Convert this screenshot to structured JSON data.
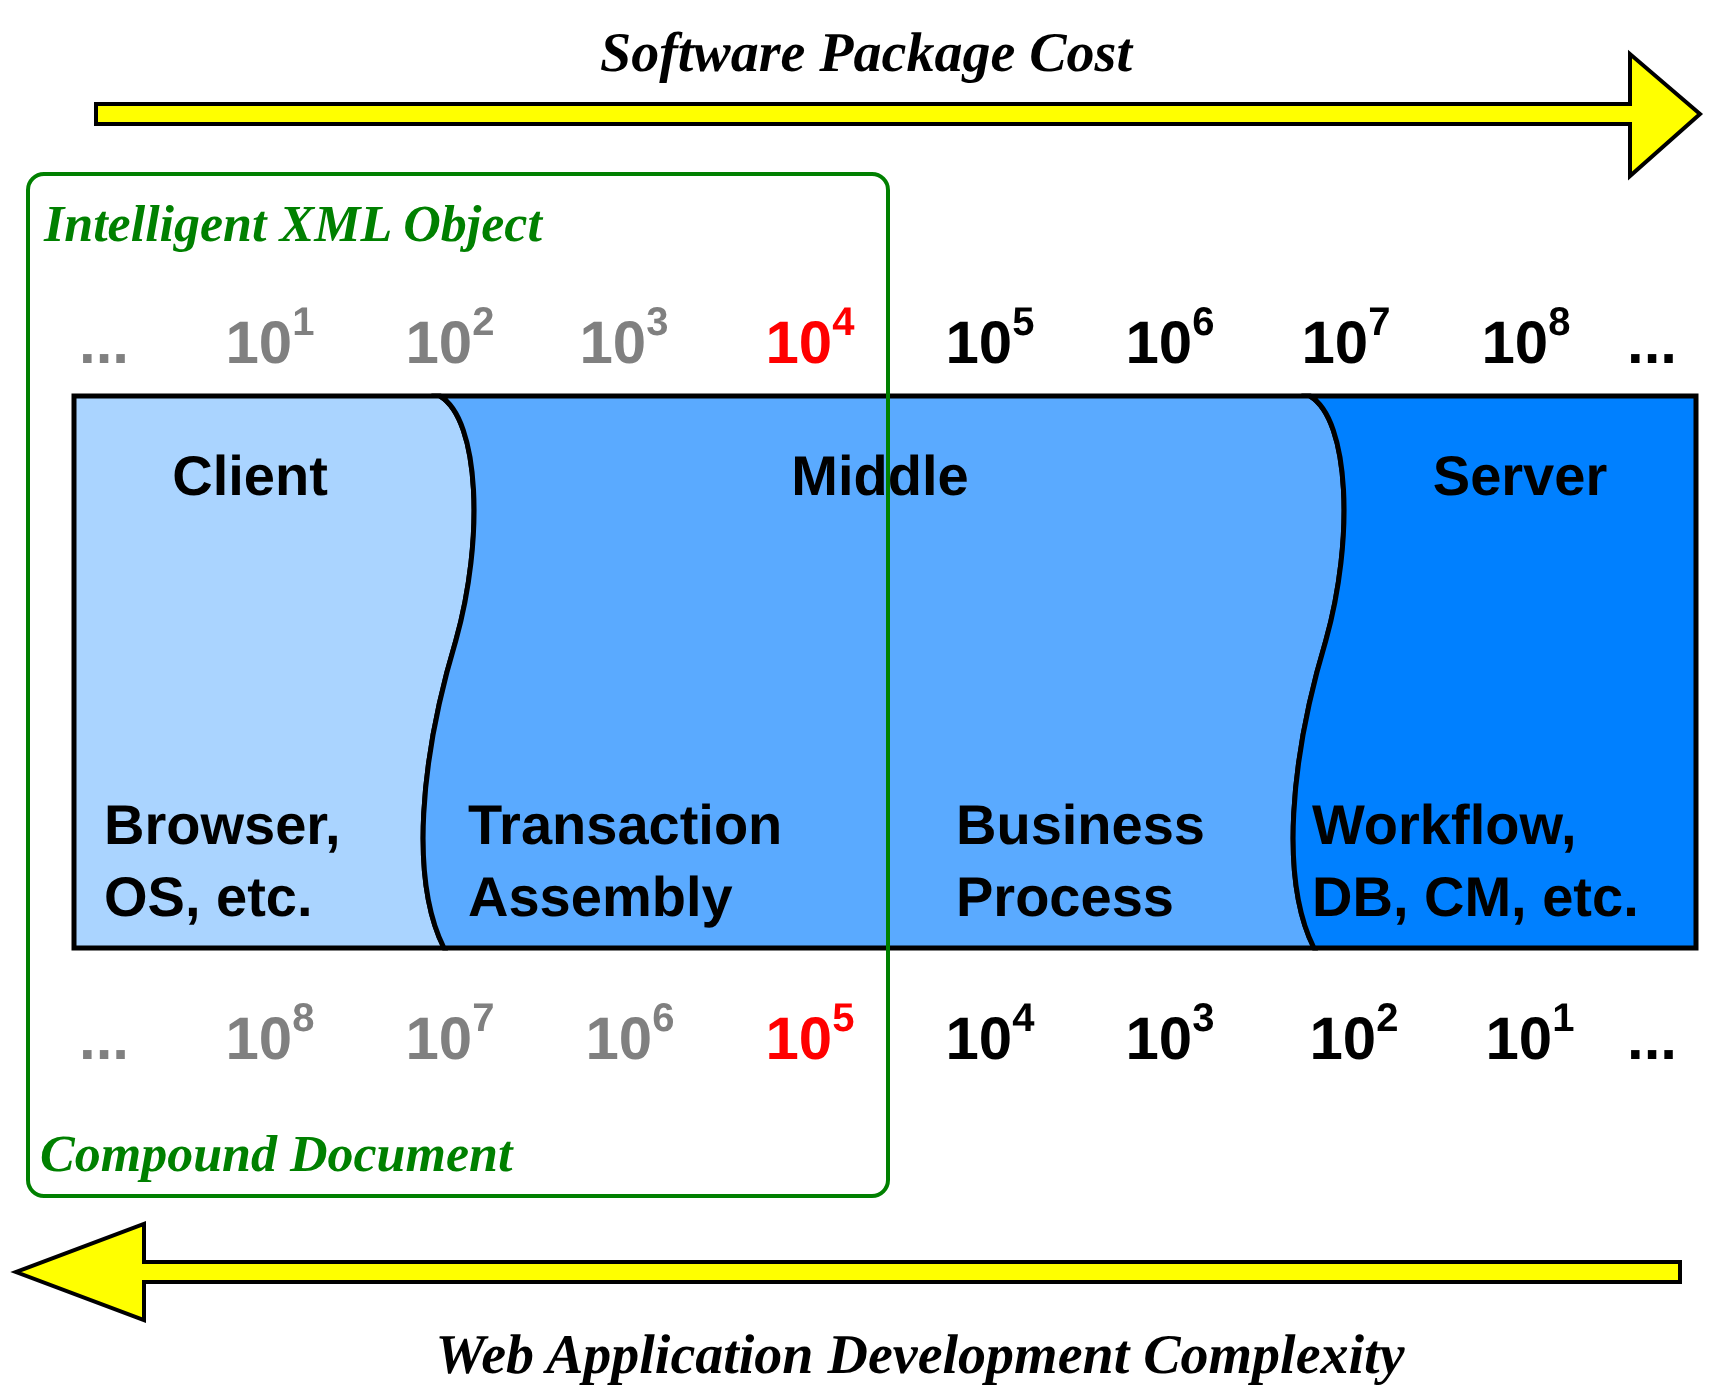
{
  "top_arrow": {
    "label": "Software Package Cost"
  },
  "frame": {
    "top_label": "Intelligent XML Object",
    "bottom_label": "Compound Document"
  },
  "top_scale": [
    {
      "text": "...",
      "color": "#808080"
    },
    {
      "text": "10$^{1}$",
      "color": "#808080"
    },
    {
      "text": "10$^{2}$",
      "color": "#808080"
    },
    {
      "text": "10$^{3}$",
      "color": "#808080"
    },
    {
      "text": "10$^{4}$",
      "color": "#ff0000"
    },
    {
      "text": "10$^{5}$",
      "color": "#000000"
    },
    {
      "text": "10$^{6}$",
      "color": "#000000"
    },
    {
      "text": "10$^{7}$",
      "color": "#000000"
    },
    {
      "text": "10$^{8}$",
      "color": "#000000"
    },
    {
      "text": "...",
      "color": "#000000"
    }
  ],
  "tiers": [
    {
      "name": "Client",
      "color": "#aad4ff",
      "captions": [
        [
          "Browser,",
          "OS, etc."
        ]
      ]
    },
    {
      "name": "Middle",
      "color": "#5aaaff",
      "captions": [
        [
          "Transaction",
          "Assembly"
        ],
        [
          "Business",
          "Process"
        ]
      ]
    },
    {
      "name": "Server",
      "color": "#0080ff",
      "captions": [
        [
          "Workflow,",
          "DB, CM, etc."
        ]
      ]
    }
  ],
  "bottom_scale": [
    {
      "text": "...",
      "color": "#808080"
    },
    {
      "text": "10$^{8}$",
      "color": "#808080"
    },
    {
      "text": "10$^{7}$",
      "color": "#808080"
    },
    {
      "text": "10$^{6}$",
      "color": "#808080"
    },
    {
      "text": "10$^{5}$",
      "color": "#ff0000"
    },
    {
      "text": "10$^{4}$",
      "color": "#000000"
    },
    {
      "text": "10$^{3}$",
      "color": "#000000"
    },
    {
      "text": "10$^{2}$",
      "color": "#000000"
    },
    {
      "text": "10$^{1}$",
      "color": "#000000"
    },
    {
      "text": "...",
      "color": "#000000"
    }
  ],
  "bottom_arrow": {
    "label": "Web Application Development Complexity"
  }
}
